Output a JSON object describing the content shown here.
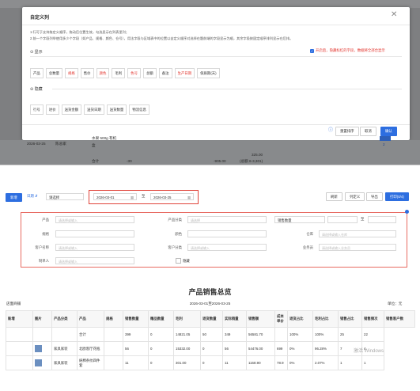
{
  "top": {
    "dialog": {
      "title": "自定义列",
      "tips": [
        "1.行可于支持拖定义顺序，拖动后位置生效，勾选显示在列表里列；",
        "2.前一个字段列举使用多少个字段（如产品、规格、颜色、仓号），用法字段与区域表中的位置以自定义顺序对选择在题前端的字段显示为顺，其余字段按固定顺序排列显示在后排。"
      ],
      "show_section": "显示",
      "hidden_section": "隐藏",
      "notice_label": "开启后，隐藏标红的字段，数据将全部合显示",
      "shown_columns": [
        {
          "label": "产品",
          "red": false
        },
        {
          "label": "总数量",
          "red": false
        },
        {
          "label": "规格",
          "red": true
        },
        {
          "label": "售价",
          "red": false
        },
        {
          "label": "颜色",
          "red": true
        },
        {
          "label": "毛利",
          "red": false
        },
        {
          "label": "色号",
          "red": true
        },
        {
          "label": "总额",
          "red": false
        },
        {
          "label": "备注",
          "red": false
        },
        {
          "label": "生产日期",
          "red": true
        },
        {
          "label": "保质期(天)",
          "red": false
        }
      ],
      "hidden_columns": [
        "行号",
        "进价",
        "送货金额",
        "送货日期",
        "送货数量",
        "物流信息"
      ],
      "buttons": {
        "reset": "重置排序",
        "cancel": "取消",
        "ok": "确认"
      }
    },
    "background": {
      "date": "2026-03-25",
      "warehouse": "陈总家",
      "product": "水果 500g 有机",
      "qty_label": "盒",
      "total_label": "合计",
      "total_value": "-30",
      "neg_amount": "-905.00",
      "amount": "325.00",
      "amount_note": "(总额 6-3,301)",
      "right_value": "2"
    }
  },
  "bottom": {
    "toolbar": {
      "add_button": "新增",
      "date_type_label": "日期",
      "period_select": "请选择",
      "date_start": "2026-03-01",
      "date_to": "至",
      "date_end": "2026-03-25",
      "refresh": "刷新",
      "columns": "列定义",
      "export": "导出",
      "print": "打印(0/4)"
    },
    "filters": {
      "product_label": "产品",
      "product_ph": "请选择或输入",
      "category_label": "产品分类",
      "category_ph": "请选择",
      "sales_qty_label": "销售数量",
      "sales_qty_to": "至",
      "spec_label": "规格",
      "color_label": "颜色",
      "warehouse_label": "仓库",
      "warehouse_ph": "请选择或输入仓库",
      "customer_label": "客户名称",
      "customer_ph": "请选择或输入",
      "customer_cat_label": "客户分类",
      "customer_cat_ph": "请选择或输入",
      "salesman_label": "业务员",
      "salesman_ph": "请选择或输入业务员",
      "maker_label": "制单人",
      "maker_ph": "请选择或输入",
      "hide_label": "隐藏"
    },
    "report": {
      "title": "产品销售总览",
      "shop": "店面商铺",
      "period": "2026-03-01至2026-03-25",
      "unit": "单位：元",
      "headers": [
        "新增",
        "图片",
        "产品分类",
        "产品",
        "规格",
        "销售数量",
        "赠品数量",
        "毛利",
        "退货数量",
        "实际销量",
        "销售额",
        "成本单价",
        "退货占比",
        "毛利占比",
        "销售占比",
        "销售频次",
        "销售客户数"
      ],
      "rows": [
        {
          "pic": false,
          "cells": [
            "",
            "",
            "",
            "合计",
            "",
            "399",
            "0",
            "14821.05",
            "50",
            "349",
            "56581.70",
            "",
            "100%",
            "100%",
            "25",
            "22"
          ]
        },
        {
          "pic": true,
          "cells": [
            "",
            "",
            "家具家装",
            "北欧客厅花瓶",
            "",
            "56",
            "0",
            "15332.00",
            "0",
            "56",
            "54476.00",
            "699",
            "0%",
            "96.28%",
            "7",
            "4"
          ]
        },
        {
          "pic": true,
          "cells": [
            "",
            "",
            "家具家装",
            "純棉条纹四件套",
            "",
            "11",
            "0",
            "301.00",
            "0",
            "11",
            "1168.90",
            "78.9",
            "0%",
            "2.07%",
            "1",
            "1"
          ]
        }
      ]
    },
    "watermark": "激活 Windows"
  }
}
